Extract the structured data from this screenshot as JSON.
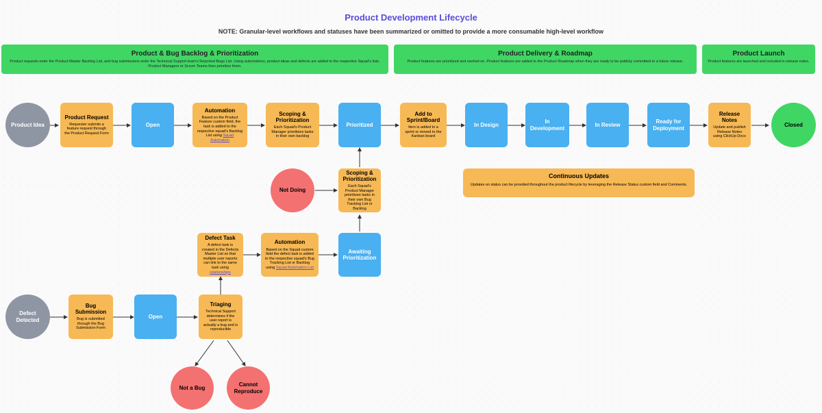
{
  "title": "Product Development Lifecycle",
  "subtitle": "NOTE: Granular-level workflows and statuses have been summarized or omitted to provide a more consumable high-level workflow",
  "lanes": [
    {
      "title": "Product & Bug Backlog & Prioritization",
      "desc": "Product requests enter the Product Master Backlog List, and bug submissions enter the Technical Support team's Reported Bugs List. Using automations, product ideas and defects are added to the respective Squad's lists. Product Managers or Scrum Teams then prioritize them."
    },
    {
      "title": "Product Delivery & Roadmap",
      "desc": "Product features are prioritized and worked on. Product features are added to the Product Roadmap when they are ready to be publicly committed to a future release."
    },
    {
      "title": "Product Launch",
      "desc": "Product features are launched and included in release notes."
    }
  ],
  "row1": {
    "idea": "Product Idea",
    "request": {
      "title": "Product Request",
      "desc": "Requester submits a feature request through the Product Request Form"
    },
    "open": "Open",
    "automation": {
      "title": "Automation",
      "desc": "Based on the Product Feature custom field, the task is added to the respective squad's Backlog List using ",
      "link": "Squad Automation"
    },
    "scoping": {
      "title": "Scoping & Prioritization",
      "desc": "Each Squad's Product Manager prioritizes tasks in their own backlog"
    },
    "prioritized": "Prioritized",
    "add": {
      "title": "Add to Sprint/Board",
      "desc": "Item is added to a sprint or moved to the Kanban board"
    },
    "design": "In Design",
    "dev": "In Development",
    "review": "In Review",
    "ready": "Ready for Deployment",
    "release": {
      "title": "Release Notes",
      "desc": "Update and publish Release Notes using ClickUp Docs"
    },
    "closed": "Closed"
  },
  "mid": {
    "notdoing": "Not Doing",
    "scoping2": {
      "title": "Scoping & Prioritization",
      "desc": "Each Squad's Product Manager prioritizes tasks in their own Bug Tracking List or Backlog"
    },
    "updates": {
      "title": "Continuous Updates",
      "desc": "Updates on status can be provided throughout the product lifecycle by leveraging the Release Status custom field and Comments."
    }
  },
  "row2": {
    "defecttask": {
      "title": "Defect Task",
      "desc": "A defect task is created in the Defects Master List so that multiple user reports can link to the same task using ",
      "link": "relationships"
    },
    "automation2": {
      "title": "Automation",
      "desc": "Based on the Squad custom field the defect task is added to the respective squad's Bug Tracking List or Backlog using ",
      "link": "Squad Automation List"
    },
    "awaiting": "Awaiting Prioritization"
  },
  "row3": {
    "defect": "Defect Detected",
    "bugsub": {
      "title": "Bug Submission",
      "desc": "Bug is submitted through the Bug Submission Form"
    },
    "open2": "Open",
    "triaging": {
      "title": "Triaging",
      "desc": "Technical Support determines if the user report is actually a bug and is reproducible"
    },
    "notabug": "Not a Bug",
    "cannot": "Cannot Reproduce"
  }
}
